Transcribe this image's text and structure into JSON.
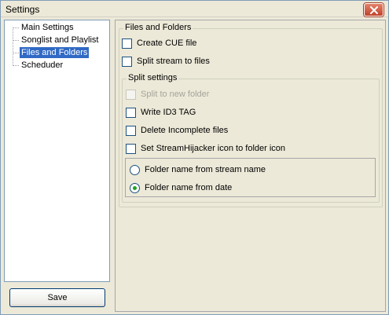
{
  "window": {
    "title": "Settings",
    "close_icon": "close-icon"
  },
  "tree": {
    "items": [
      {
        "label": "Main Settings",
        "selected": false
      },
      {
        "label": "Songlist and Playlist",
        "selected": false
      },
      {
        "label": "Files and Folders",
        "selected": true
      },
      {
        "label": "Scheduder",
        "selected": false
      }
    ]
  },
  "footer": {
    "save_label": "Save"
  },
  "panel": {
    "files_group": {
      "legend": "Files and Folders",
      "create_cue": {
        "label": "Create CUE file",
        "checked": false
      },
      "split_stream": {
        "label": "Split stream to files",
        "checked": false
      }
    },
    "split_group": {
      "legend": "Split settings",
      "split_new_folder": {
        "label": "Split to new folder",
        "checked": false,
        "disabled": true
      },
      "write_id3": {
        "label": "Write ID3 TAG",
        "checked": false
      },
      "delete_incomplete": {
        "label": "Delete Incomplete files",
        "checked": false
      },
      "set_icon": {
        "label": "Set StreamHijacker icon to folder icon",
        "checked": false
      },
      "folder_naming": {
        "options": [
          {
            "label": "Folder name from stream name",
            "checked": false
          },
          {
            "label": "Folder name from date",
            "checked": true
          }
        ]
      }
    }
  },
  "colors": {
    "selection": "#316ac5",
    "window_bg": "#ece9d8",
    "radio_dot": "#21a121"
  }
}
